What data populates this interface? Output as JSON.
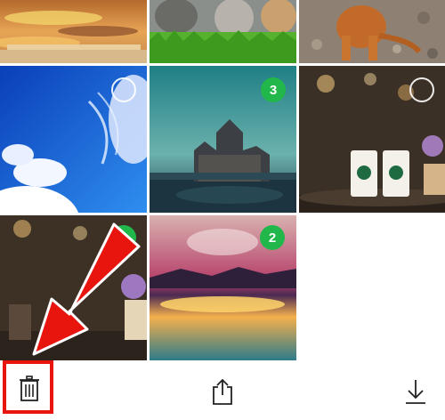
{
  "photos": [
    {
      "name": "sunset-clouds",
      "selection": null
    },
    {
      "name": "kittens-grass",
      "selection": null
    },
    {
      "name": "puppy-rocks",
      "selection": null
    },
    {
      "name": "blue-sky",
      "selection": {
        "state": "unselected"
      }
    },
    {
      "name": "castle-lake",
      "selection": {
        "state": "selected",
        "order": "3"
      }
    },
    {
      "name": "cafe-cups",
      "selection": {
        "state": "unselected"
      }
    },
    {
      "name": "cafe-flowers",
      "selection": {
        "state": "selected",
        "order": "1"
      }
    },
    {
      "name": "sunset-reflection",
      "selection": {
        "state": "selected",
        "order": "2"
      }
    }
  ],
  "toolbar": {
    "delete_icon": "trash-icon",
    "share_icon": "share-icon",
    "download_icon": "download-icon"
  },
  "colors": {
    "selected_badge": "#22b74a",
    "annotation_red": "#e8140e"
  }
}
